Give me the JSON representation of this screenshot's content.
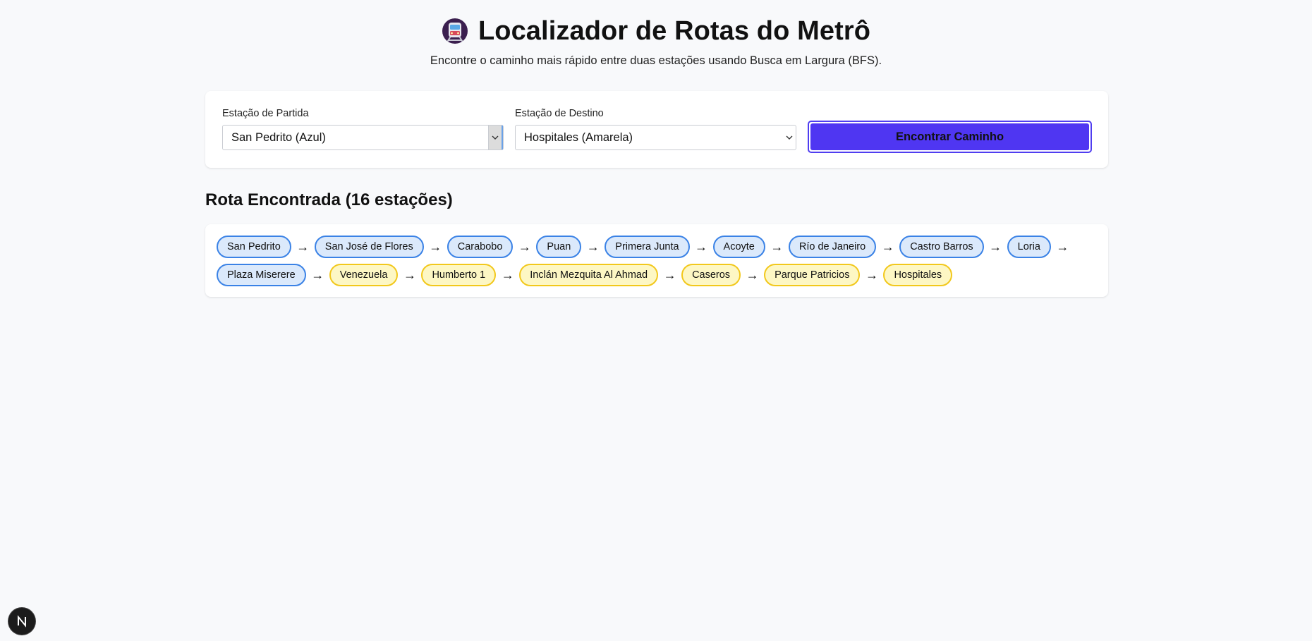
{
  "header": {
    "icon": "metro-train-icon",
    "title": "Localizador de Rotas do Metrô",
    "subtitle": "Encontre o caminho mais rápido entre duas estações usando Busca em Largura (BFS)."
  },
  "form": {
    "origin_label": "Estação de Partida",
    "origin_value": "San Pedrito (Azul)",
    "destination_label": "Estação de Destino",
    "destination_value": "Hospitales (Amarela)",
    "submit_label": "Encontrar Caminho"
  },
  "result": {
    "heading": "Rota Encontrada (16 estações)",
    "arrow": "→",
    "stations": [
      {
        "name": "San Pedrito",
        "line": "blue"
      },
      {
        "name": "San José de Flores",
        "line": "blue"
      },
      {
        "name": "Carabobo",
        "line": "blue"
      },
      {
        "name": "Puan",
        "line": "blue"
      },
      {
        "name": "Primera Junta",
        "line": "blue"
      },
      {
        "name": "Acoyte",
        "line": "blue"
      },
      {
        "name": "Río de Janeiro",
        "line": "blue"
      },
      {
        "name": "Castro Barros",
        "line": "blue"
      },
      {
        "name": "Loria",
        "line": "blue"
      },
      {
        "name": "Plaza Miserere",
        "line": "blue"
      },
      {
        "name": "Venezuela",
        "line": "yellow"
      },
      {
        "name": "Humberto 1",
        "line": "yellow"
      },
      {
        "name": "Inclán Mezquita Al Ahmad",
        "line": "yellow"
      },
      {
        "name": "Caseros",
        "line": "yellow"
      },
      {
        "name": "Parque Patricios",
        "line": "yellow"
      },
      {
        "name": "Hospitales",
        "line": "yellow"
      }
    ]
  },
  "colors": {
    "background": "#f8f9fb",
    "button": "#4f36f2",
    "blue_line_border": "#3a82e6",
    "blue_line_fill": "#dbe9fb",
    "yellow_line_border": "#f2c81c",
    "yellow_line_fill": "#fdf7c4"
  },
  "dev_badge": {
    "icon": "nextjs-n-icon",
    "letter": "N"
  }
}
